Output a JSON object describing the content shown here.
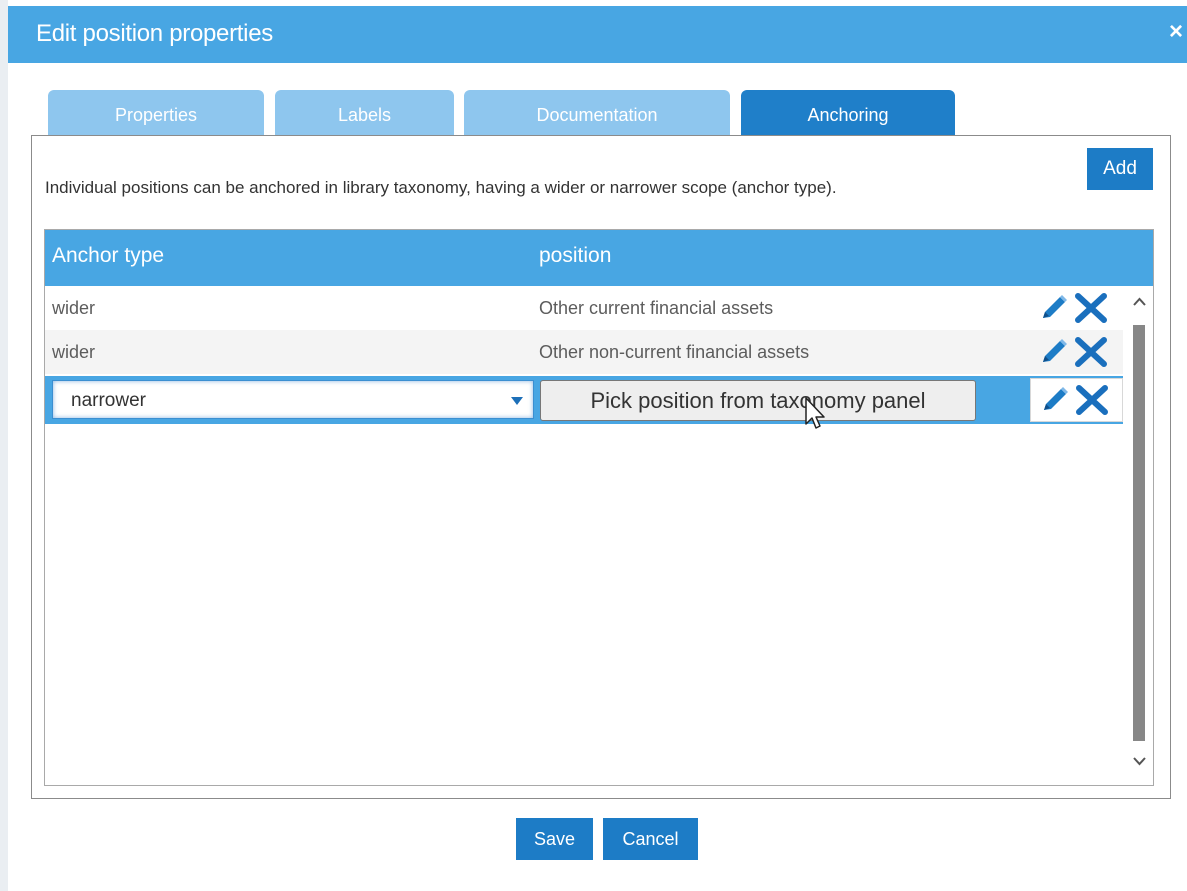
{
  "dialog": {
    "title": "Edit position properties",
    "close_label": "×"
  },
  "tabs": [
    {
      "label": "Properties",
      "active": false
    },
    {
      "label": "Labels",
      "active": false
    },
    {
      "label": "Documentation",
      "active": false
    },
    {
      "label": "Anchoring",
      "active": true
    }
  ],
  "anchoring": {
    "add_label": "Add",
    "description": "Individual positions can be anchored in library taxonomy, having a wider or narrower scope (anchor type).",
    "columns": [
      "Anchor type",
      "position"
    ],
    "rows": [
      {
        "anchor_type": "wider",
        "position": "Other current financial assets",
        "actions": [
          "pencil-icon",
          "close-icon"
        ]
      },
      {
        "anchor_type": "wider",
        "position": "Other non-current financial assets",
        "actions": [
          "pencil-icon",
          "close-icon"
        ]
      }
    ],
    "edit_row": {
      "anchor_type_value": "narrower",
      "pick_button_label": "Pick position from taxonomy panel",
      "actions": [
        "pencil-icon",
        "close-icon"
      ]
    }
  },
  "footer": {
    "save_label": "Save",
    "cancel_label": "Cancel"
  },
  "colors": {
    "accent": "#48a6e3",
    "button": "#1d7cc6",
    "tab_inactive": "#8ec6ee",
    "tab_active": "#1f7fc9"
  }
}
